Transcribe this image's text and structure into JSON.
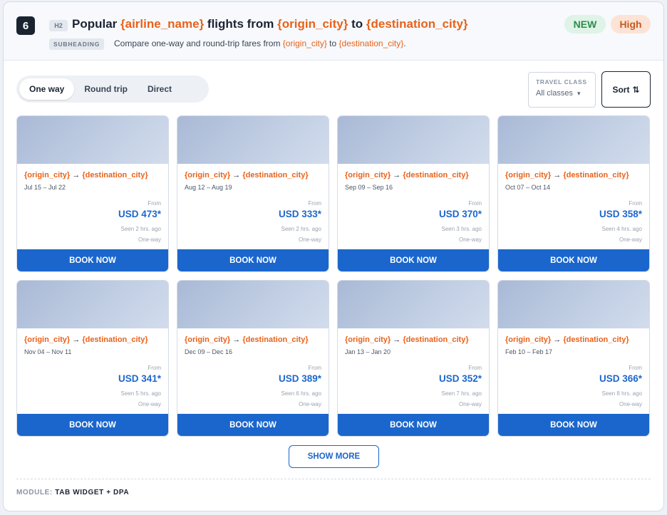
{
  "header": {
    "number": "6",
    "heading_tag": "H2",
    "title_parts": [
      "Popular ",
      "{airline_name}",
      " flights from ",
      "{origin_city}",
      " to ",
      "{destination_city}"
    ],
    "subheading_tag": "SUBHEADING",
    "subtitle_parts": [
      "Compare one-way and round-trip fares from ",
      "{origin_city}",
      " to ",
      "{destination_city}",
      "."
    ],
    "badge_new": "NEW",
    "badge_priority": "High"
  },
  "tabs": [
    {
      "label": "One way",
      "active": true
    },
    {
      "label": "Round trip",
      "active": false
    },
    {
      "label": "Direct",
      "active": false
    }
  ],
  "travel_class": {
    "label": "TRAVEL CLASS",
    "value": "All classes",
    "caret": "▾"
  },
  "sort": {
    "label": "Sort",
    "icon": "⇅"
  },
  "flights": [
    {
      "origin": "{origin_city}",
      "arrow": "→",
      "destination": "{destination_city}",
      "dates": "Jul 15 – Jul 22",
      "from": "From",
      "price": "USD 473*",
      "seen": "Seen 2 hrs. ago",
      "type": "One-way",
      "cta": "BOOK NOW"
    },
    {
      "origin": "{origin_city}",
      "arrow": "→",
      "destination": "{destination_city}",
      "dates": "Aug 12 – Aug 19",
      "from": "From",
      "price": "USD 333*",
      "seen": "Seen 2 hrs. ago",
      "type": "One-way",
      "cta": "BOOK NOW"
    },
    {
      "origin": "{origin_city}",
      "arrow": "→",
      "destination": "{destination_city}",
      "dates": "Sep 09 – Sep 16",
      "from": "From",
      "price": "USD 370*",
      "seen": "Seen 3 hrs. ago",
      "type": "One-way",
      "cta": "BOOK NOW"
    },
    {
      "origin": "{origin_city}",
      "arrow": "→",
      "destination": "{destination_city}",
      "dates": "Oct 07 – Oct 14",
      "from": "From",
      "price": "USD 358*",
      "seen": "Seen 4 hrs. ago",
      "type": "One-way",
      "cta": "BOOK NOW"
    },
    {
      "origin": "{origin_city}",
      "arrow": "→",
      "destination": "{destination_city}",
      "dates": "Nov 04 – Nov 11",
      "from": "From",
      "price": "USD 341*",
      "seen": "Seen 5 hrs. ago",
      "type": "One-way",
      "cta": "BOOK NOW"
    },
    {
      "origin": "{origin_city}",
      "arrow": "→",
      "destination": "{destination_city}",
      "dates": "Dec 09 – Dec 16",
      "from": "From",
      "price": "USD 389*",
      "seen": "Seen 6 hrs. ago",
      "type": "One-way",
      "cta": "BOOK NOW"
    },
    {
      "origin": "{origin_city}",
      "arrow": "→",
      "destination": "{destination_city}",
      "dates": "Jan 13 – Jan 20",
      "from": "From",
      "price": "USD 352*",
      "seen": "Seen 7 hrs. ago",
      "type": "One-way",
      "cta": "BOOK NOW"
    },
    {
      "origin": "{origin_city}",
      "arrow": "→",
      "destination": "{destination_city}",
      "dates": "Feb 10 – Feb 17",
      "from": "From",
      "price": "USD 366*",
      "seen": "Seen 8 hrs. ago",
      "type": "One-way",
      "cta": "BOOK NOW"
    }
  ],
  "show_more": "SHOW MORE",
  "module": {
    "label": "MODULE:",
    "value": "TAB WIDGET + DPA"
  },
  "colors": {
    "accent_orange": "#e8621a",
    "price_blue": "#1d67cc",
    "cta_blue": "#1a66cc",
    "badge_new_bg": "#dff3e6",
    "badge_high_bg": "#fde3d6"
  }
}
